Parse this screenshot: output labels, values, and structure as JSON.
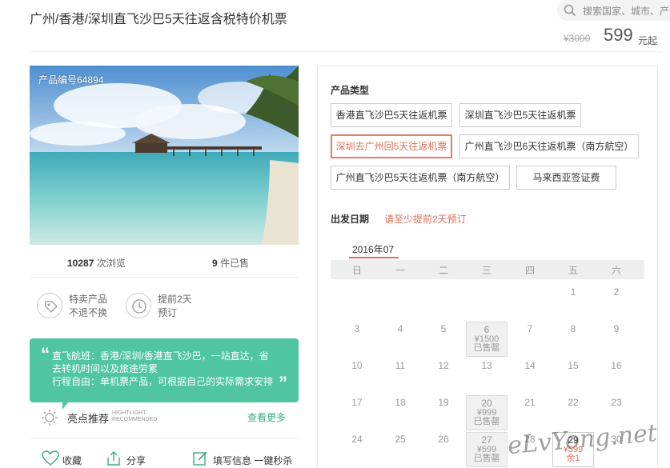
{
  "header": {
    "title": "广州/香港/深圳直飞沙巴5天往返含税特价机票",
    "search_placeholder": "搜索国家、城市、产",
    "original_price": "¥3000",
    "price": "599",
    "price_unit": "元起"
  },
  "product": {
    "id_label": "产品编号64894",
    "views_count": "10287",
    "views_label": "次浏览",
    "sold_count": "9",
    "sold_label": "件已售"
  },
  "features": [
    {
      "line1": "特卖产品",
      "line2": "不退不换",
      "icon": "tag-icon"
    },
    {
      "line1": "提前2天",
      "line2": "预订",
      "icon": "clock-icon"
    }
  ],
  "recommend": {
    "lines": [
      "直飞航班：香港/深圳/香港直飞沙巴，一站直达，省",
      "去转机时间以及旅途劳累",
      "行程自由：单机票产品，可根据自己的实际需求安排"
    ],
    "label": "亮点推荐",
    "sub1": "HIGHTLIGHT",
    "sub2": "RECOMMENDED",
    "more": "查看更多"
  },
  "actions": {
    "favorite": "收藏",
    "share": "分享",
    "fill_info": "填写信息 一键秒杀"
  },
  "options": {
    "label": "产品类型",
    "items": [
      "香港直飞沙巴5天往返机票",
      "深圳直飞沙巴5天往返机票",
      "深圳去广州回5天往返机票",
      "广州直飞沙巴6天往返机票（南方航空）",
      "广州直飞沙巴5天往返机票（南方航空）",
      "马来西亚签证费"
    ],
    "selected_index": 2
  },
  "calendar": {
    "label": "出发日期",
    "warning": "请至少提前2天预订",
    "month": "2016年07",
    "weekdays": [
      "日",
      "一",
      "二",
      "三",
      "四",
      "五",
      "六"
    ],
    "days": [
      {
        "d": "1",
        "col": 5,
        "row": 0
      },
      {
        "d": "2",
        "col": 6,
        "row": 0
      },
      {
        "d": "3",
        "col": 0,
        "row": 1
      },
      {
        "d": "4",
        "col": 1,
        "row": 1
      },
      {
        "d": "5",
        "col": 2,
        "row": 1
      },
      {
        "d": "6",
        "col": 3,
        "row": 1,
        "status": "sold",
        "price": "¥1500",
        "note": "已售罄"
      },
      {
        "d": "7",
        "col": 4,
        "row": 1
      },
      {
        "d": "8",
        "col": 5,
        "row": 1
      },
      {
        "d": "9",
        "col": 6,
        "row": 1
      },
      {
        "d": "10",
        "col": 0,
        "row": 2
      },
      {
        "d": "11",
        "col": 1,
        "row": 2
      },
      {
        "d": "12",
        "col": 2,
        "row": 2
      },
      {
        "d": "13",
        "col": 3,
        "row": 2
      },
      {
        "d": "14",
        "col": 4,
        "row": 2
      },
      {
        "d": "15",
        "col": 5,
        "row": 2
      },
      {
        "d": "16",
        "col": 6,
        "row": 2
      },
      {
        "d": "17",
        "col": 0,
        "row": 3
      },
      {
        "d": "18",
        "col": 1,
        "row": 3
      },
      {
        "d": "19",
        "col": 2,
        "row": 3
      },
      {
        "d": "20",
        "col": 3,
        "row": 3,
        "status": "sold",
        "price": "¥999",
        "note": "已售罄"
      },
      {
        "d": "21",
        "col": 4,
        "row": 3
      },
      {
        "d": "22",
        "col": 5,
        "row": 3
      },
      {
        "d": "23",
        "col": 6,
        "row": 3
      },
      {
        "d": "24",
        "col": 0,
        "row": 4
      },
      {
        "d": "25",
        "col": 1,
        "row": 4
      },
      {
        "d": "26",
        "col": 2,
        "row": 4
      },
      {
        "d": "27",
        "col": 3,
        "row": 4,
        "status": "sold",
        "price": "¥599",
        "note": "已售罄"
      },
      {
        "d": "28",
        "col": 4,
        "row": 4
      },
      {
        "d": "29",
        "col": 5,
        "row": 4,
        "status": "avail",
        "price": "¥599",
        "note": "余1"
      },
      {
        "d": "30",
        "col": 6,
        "row": 4
      }
    ]
  },
  "watermark": "eLvYong.net",
  "colors": {
    "accent_green": "#4fc5a0",
    "accent_red": "#e16d5b"
  }
}
